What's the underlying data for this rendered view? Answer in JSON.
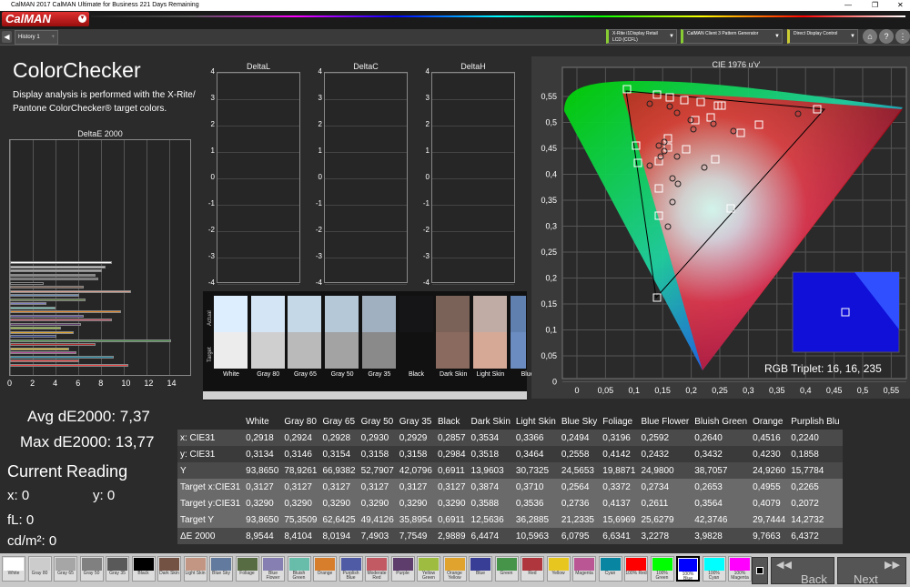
{
  "window": {
    "title": "CalMAN 2017 CalMAN Ultimate for Business 221 Days Remaining"
  },
  "brand": {
    "logo": "CalMAN"
  },
  "tabs": [
    {
      "label": "History 1"
    }
  ],
  "devices": [
    {
      "label": "X-Rite i1Display Retail LCD (CCFL)"
    },
    {
      "label": "CalMAN Client 3 Pattern Generator"
    },
    {
      "label": "Direct Display Control"
    }
  ],
  "page": {
    "title": "ColorChecker",
    "description": "Display analysis is performed with the X-Rite/ Pantone ColorChecker® target colors."
  },
  "deltae_chart": {
    "title": "DeltaE 2000",
    "xticks": [
      "0",
      "2",
      "4",
      "6",
      "8",
      "10",
      "12",
      "14"
    ],
    "values": [
      8.9544,
      8.4104,
      8.0194,
      7.4903,
      7.7549,
      2.9889,
      6.4474,
      10.5963,
      6.0795,
      6.6341,
      3.2278,
      3.9828,
      9.7663,
      6.4372,
      8.9,
      6.2,
      4.5,
      5.6,
      4.1,
      14.1,
      7.5,
      5.2,
      5.8,
      9.1,
      6.1,
      10.4
    ],
    "colors": [
      "#ffffff",
      "#c8c8c8",
      "#a8a8a8",
      "#888888",
      "#707070",
      "#222222",
      "#7a5c4c",
      "#d6a08e",
      "#6a8ab4",
      "#5e7a40",
      "#8080c0",
      "#6ac0b0",
      "#e0862a",
      "#5e4a9e",
      "#c04a5e",
      "#5e3c6c",
      "#9cc43c",
      "#e0a42a",
      "#2a3e8e",
      "#4a9448",
      "#b02c2c",
      "#e8c828",
      "#b04a98",
      "#1a86a4",
      "#e84040",
      "#e84040"
    ]
  },
  "delta_charts": [
    {
      "title": "DeltaL",
      "yticks": [
        "4",
        "3",
        "2",
        "1",
        "0",
        "-1",
        "-2",
        "-3",
        "-4"
      ]
    },
    {
      "title": "DeltaC",
      "yticks": [
        "4",
        "3",
        "2",
        "1",
        "0",
        "-1",
        "-2",
        "-3",
        "-4"
      ]
    },
    {
      "title": "DeltaH",
      "yticks": [
        "4",
        "3",
        "2",
        "1",
        "0",
        "-1",
        "-2",
        "-3",
        "-4"
      ]
    }
  ],
  "swatch_strip": {
    "actual_label": "Actual",
    "target_label": "Target",
    "items": [
      {
        "name": "White",
        "actual": "#ddeeff",
        "target": "#ececec"
      },
      {
        "name": "Gray 80",
        "actual": "#d4e6f6",
        "target": "#cfcfcf"
      },
      {
        "name": "Gray 65",
        "actual": "#c4d8e8",
        "target": "#bababa"
      },
      {
        "name": "Gray 50",
        "actual": "#b4c8d8",
        "target": "#a3a3a3"
      },
      {
        "name": "Gray 35",
        "actual": "#a0b0c0",
        "target": "#8a8a8a"
      },
      {
        "name": "Black",
        "actual": "#151518",
        "target": "#111111"
      },
      {
        "name": "Dark Skin",
        "actual": "#7a6258",
        "target": "#8a6a5e"
      },
      {
        "name": "Light Skin",
        "actual": "#c0aca4",
        "target": "#d6a896"
      },
      {
        "name": "Blue",
        "actual": "#6080b0",
        "target": "#6a8cc0"
      }
    ]
  },
  "cie_chart": {
    "title": "CIE 1976 u'v'",
    "xticks": [
      "0",
      "0,05",
      "0,1",
      "0,15",
      "0,2",
      "0,25",
      "0,3",
      "0,35",
      "0,4",
      "0,45",
      "0,5",
      "0,55"
    ],
    "yticks": [
      "0,55",
      "0,5",
      "0,45",
      "0,4",
      "0,35",
      "0,3",
      "0,25",
      "0,2",
      "0,15",
      "0,1",
      "0,05",
      "0"
    ],
    "rgb_triplet": "RGB Triplet: 16, 16, 235"
  },
  "stats": {
    "avg": "Avg dE2000: 7,37",
    "max": "Max dE2000: 13,77"
  },
  "reading": {
    "title": "Current Reading",
    "x": "x: 0",
    "y": "y: 0",
    "fl": "fL: 0",
    "cdm": "cd/m²: 0"
  },
  "table": {
    "headers": [
      "",
      "White",
      "Gray 80",
      "Gray 65",
      "Gray 50",
      "Gray 35",
      "Black",
      "Dark Skin",
      "Light Skin",
      "Blue Sky",
      "Foliage",
      "Blue Flower",
      "Bluish Green",
      "Orange",
      "Purplish Blu"
    ],
    "rows": [
      [
        "x: CIE31",
        "0,2918",
        "0,2924",
        "0,2928",
        "0,2930",
        "0,2929",
        "0,2857",
        "0,3534",
        "0,3366",
        "0,2494",
        "0,3196",
        "0,2592",
        "0,2640",
        "0,4516",
        "0,2240"
      ],
      [
        "y: CIE31",
        "0,3134",
        "0,3146",
        "0,3154",
        "0,3158",
        "0,3158",
        "0,2984",
        "0,3518",
        "0,3464",
        "0,2558",
        "0,4142",
        "0,2432",
        "0,3432",
        "0,4230",
        "0,1858"
      ],
      [
        "Y",
        "93,8650",
        "78,9261",
        "66,9382",
        "52,7907",
        "42,0796",
        "0,6911",
        "13,9603",
        "30,7325",
        "24,5653",
        "19,8871",
        "24,9800",
        "38,7057",
        "24,9260",
        "15,7784"
      ],
      [
        "Target x:CIE31",
        "0,3127",
        "0,3127",
        "0,3127",
        "0,3127",
        "0,3127",
        "0,3127",
        "0,3874",
        "0,3710",
        "0,2564",
        "0,3372",
        "0,2734",
        "0,2653",
        "0,4955",
        "0,2265"
      ],
      [
        "Target y:CIE31",
        "0,3290",
        "0,3290",
        "0,3290",
        "0,3290",
        "0,3290",
        "0,3290",
        "0,3588",
        "0,3536",
        "0,2736",
        "0,4137",
        "0,2611",
        "0,3564",
        "0,4079",
        "0,2072"
      ],
      [
        "Target Y",
        "93,8650",
        "75,3509",
        "62,6425",
        "49,4126",
        "35,8954",
        "0,6911",
        "12,5636",
        "36,2885",
        "21,2335",
        "15,6969",
        "25,6279",
        "42,3746",
        "29,7444",
        "14,2732"
      ],
      [
        "ΔE 2000",
        "8,9544",
        "8,4104",
        "8,0194",
        "7,4903",
        "7,7549",
        "2,9889",
        "6,4474",
        "10,5963",
        "6,0795",
        "6,6341",
        "3,2278",
        "3,9828",
        "9,7663",
        "6,4372"
      ]
    ]
  },
  "bottom_swatches": [
    {
      "label": "White",
      "color": "#ffffff"
    },
    {
      "label": "Gray 80",
      "color": "#cccccc"
    },
    {
      "label": "Gray 65",
      "color": "#a6a6a6"
    },
    {
      "label": "Gray 50",
      "color": "#808080"
    },
    {
      "label": "Gray 35",
      "color": "#595959"
    },
    {
      "label": "Black",
      "color": "#000000"
    },
    {
      "label": "Dark Skin",
      "color": "#735244"
    },
    {
      "label": "Light Skin",
      "color": "#c29682"
    },
    {
      "label": "Blue Sky",
      "color": "#627a9d"
    },
    {
      "label": "Foliage",
      "color": "#576c43"
    },
    {
      "label": "Blue Flower",
      "color": "#8580b1"
    },
    {
      "label": "Bluish Green",
      "color": "#67bdaa"
    },
    {
      "label": "Orange",
      "color": "#d67e2c"
    },
    {
      "label": "Purplish Blue",
      "color": "#505ba6"
    },
    {
      "label": "Moderate Red",
      "color": "#c15a63"
    },
    {
      "label": "Purple",
      "color": "#5e3c6c"
    },
    {
      "label": "Yellow Green",
      "color": "#9dbc40"
    },
    {
      "label": "Orange Yellow",
      "color": "#e0a32e"
    },
    {
      "label": "Blue",
      "color": "#383d96"
    },
    {
      "label": "Green",
      "color": "#469449"
    },
    {
      "label": "Red",
      "color": "#af363c"
    },
    {
      "label": "Yellow",
      "color": "#e7c71f"
    },
    {
      "label": "Magenta",
      "color": "#bb5695"
    },
    {
      "label": "Cyan",
      "color": "#0885a1"
    },
    {
      "label": "100% Red",
      "color": "#ff0000"
    },
    {
      "label": "100% Green",
      "color": "#00ff00"
    },
    {
      "label": "100% Blue",
      "color": "#0000ff"
    },
    {
      "label": "100% Cyan",
      "color": "#00ffff"
    },
    {
      "label": "100% Magenta",
      "color": "#ff00ff"
    }
  ],
  "nav": {
    "back": "Back",
    "next": "Next"
  }
}
